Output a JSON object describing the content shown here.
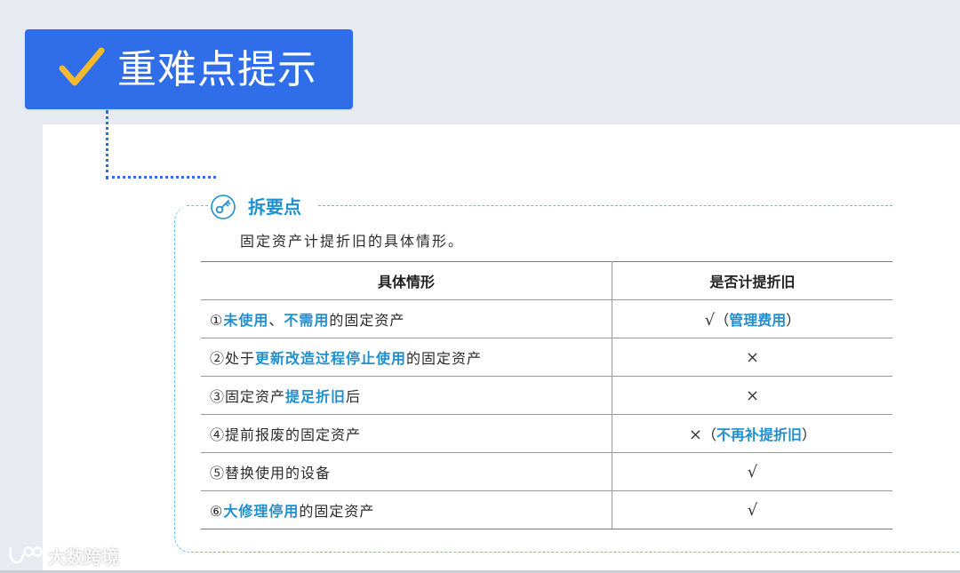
{
  "header": {
    "title": "重难点提示"
  },
  "section": {
    "heading": "拆要点",
    "intro": "固定资产计提折旧的具体情形。"
  },
  "table": {
    "headers": [
      "具体情形",
      "是否计提折旧"
    ],
    "rows": [
      {
        "situation": [
          {
            "text": "①",
            "hl": false
          },
          {
            "text": "未使用",
            "hl": true
          },
          {
            "text": "、",
            "hl": false
          },
          {
            "text": "不需用",
            "hl": true
          },
          {
            "text": "的固定资产",
            "hl": false
          }
        ],
        "result": [
          {
            "text": "√",
            "hl": false,
            "mark": true
          },
          {
            "text": "（",
            "hl": false
          },
          {
            "text": "管理费用",
            "hl": true
          },
          {
            "text": "）",
            "hl": false
          }
        ]
      },
      {
        "situation": [
          {
            "text": "②处于",
            "hl": false
          },
          {
            "text": "更新改造过程停止使用",
            "hl": true
          },
          {
            "text": "的固定资产",
            "hl": false
          }
        ],
        "result": [
          {
            "text": "×",
            "hl": false,
            "mark": true
          }
        ]
      },
      {
        "situation": [
          {
            "text": "③固定资产",
            "hl": false
          },
          {
            "text": "提足折旧",
            "hl": true
          },
          {
            "text": "后",
            "hl": false
          }
        ],
        "result": [
          {
            "text": "×",
            "hl": false,
            "mark": true
          }
        ]
      },
      {
        "situation": [
          {
            "text": "④提前报废的固定资产",
            "hl": false
          }
        ],
        "result": [
          {
            "text": "×",
            "hl": false,
            "mark": true
          },
          {
            "text": "（",
            "hl": false
          },
          {
            "text": "不再补提折旧",
            "hl": true
          },
          {
            "text": "）",
            "hl": false
          }
        ]
      },
      {
        "situation": [
          {
            "text": "⑤替换使用的设备",
            "hl": false
          }
        ],
        "result": [
          {
            "text": "√",
            "hl": false,
            "mark": true
          }
        ]
      },
      {
        "situation": [
          {
            "text": "⑥",
            "hl": false
          },
          {
            "text": "大修理停用",
            "hl": true
          },
          {
            "text": "的固定资产",
            "hl": false
          }
        ],
        "result": [
          {
            "text": "√",
            "hl": false,
            "mark": true
          }
        ]
      }
    ]
  },
  "watermark": {
    "text": "大数跨境"
  },
  "colors": {
    "badge": "#2f6ee8",
    "check": "#f5b82e",
    "highlight": "#1f8fd0",
    "dashed_border": "#5ec3e6",
    "background": "#e7ebf1"
  },
  "icons": {
    "title_icon": "checkmark-icon",
    "section_icon": "key-icon",
    "watermark_icon": "logo-icon"
  }
}
